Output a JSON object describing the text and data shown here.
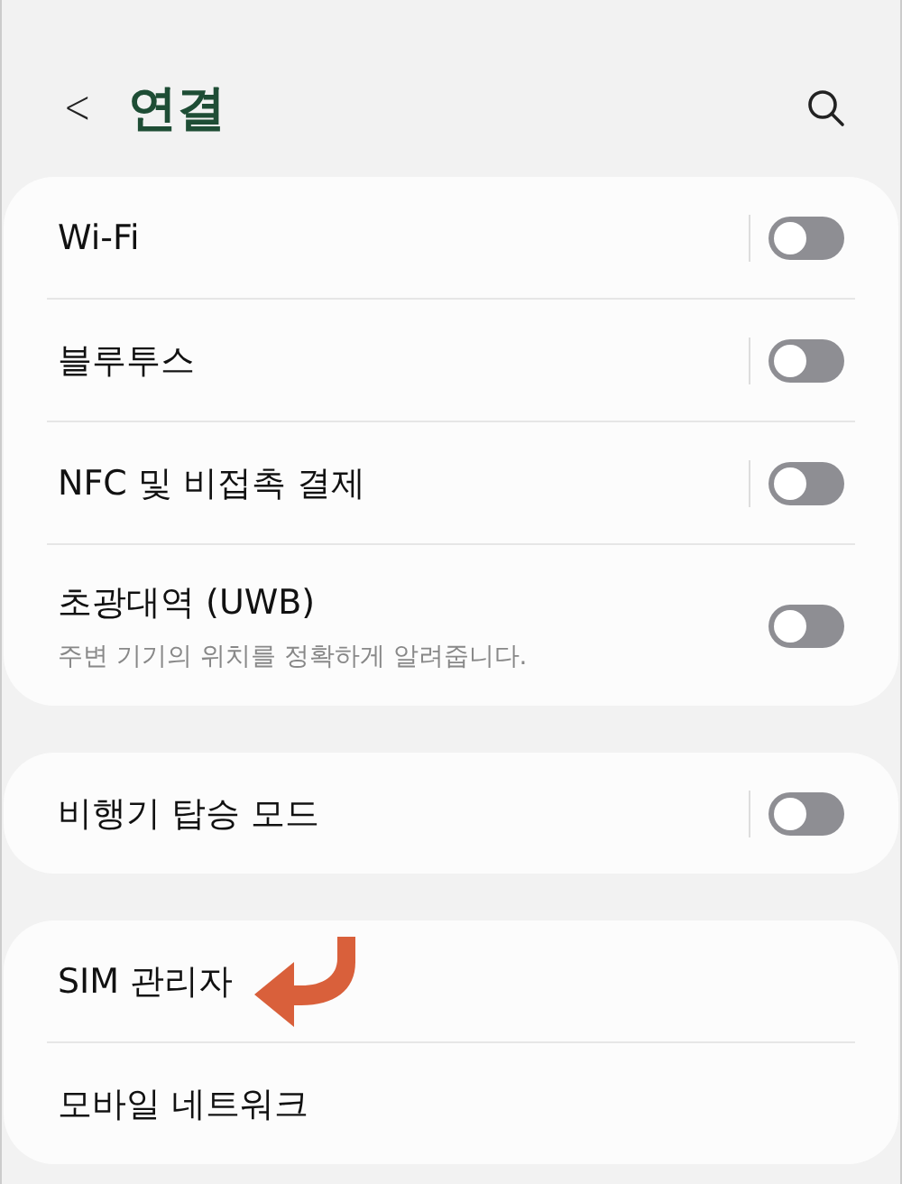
{
  "header": {
    "back": "<",
    "title": "연결"
  },
  "groups": [
    {
      "rows": [
        {
          "kind": "toggle",
          "label": "Wi-Fi",
          "on": false
        },
        {
          "kind": "toggle",
          "label": "블루투스",
          "on": false
        },
        {
          "kind": "toggle",
          "label": "NFC 및 비접촉 결제",
          "on": false
        },
        {
          "kind": "toggle",
          "label": "초광대역 (UWB)",
          "subtitle": "주변 기기의 위치를 정확하게 알려줍니다.",
          "on": false
        }
      ]
    },
    {
      "rows": [
        {
          "kind": "toggle",
          "label": "비행기 탑승 모드",
          "on": false
        }
      ]
    },
    {
      "rows": [
        {
          "kind": "link",
          "label": "SIM 관리자",
          "pointer_arrow": true
        },
        {
          "kind": "link",
          "label": "모바일 네트워크",
          "pointer_arrow": false
        }
      ]
    }
  ]
}
